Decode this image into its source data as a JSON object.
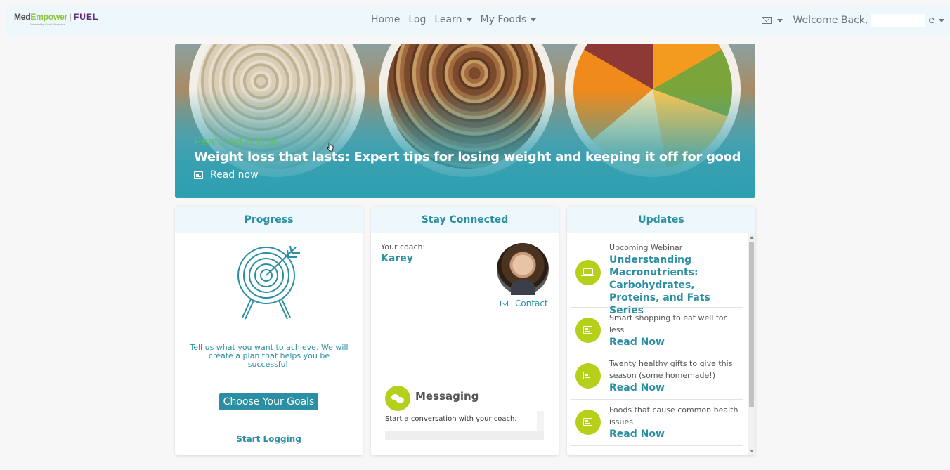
{
  "nav": {
    "logo": {
      "med": "Med",
      "empower": "Empower",
      "fuel": "FUEL",
      "tagline": "Powered by Good Measures"
    },
    "items": [
      {
        "label": "Home"
      },
      {
        "label": "Log"
      },
      {
        "label": "Learn"
      },
      {
        "label": "My Foods"
      }
    ],
    "welcome_prefix": "Welcome Back,",
    "welcome_suffix": "e"
  },
  "hero": {
    "eyebrow": "Featured Article",
    "headline": "Weight loss that lasts: Expert tips for losing weight and keeping it off for good",
    "cta": "Read now"
  },
  "progress": {
    "title": "Progress",
    "description": "Tell us what you want to achieve. We will create a plan that helps you be successful.",
    "button": "Choose Your Goals",
    "link": "Start Logging"
  },
  "connected": {
    "title": "Stay Connected",
    "coach_label": "Your coach:",
    "coach_name": "Karey",
    "contact": "Contact",
    "messaging_title": "Messaging",
    "messaging_text": "Start a conversation with your coach."
  },
  "updates": {
    "title": "Updates",
    "items": [
      {
        "pre": "Upcoming Webinar",
        "link": "Understanding Macronutrients: Carbohydrates, Proteins, and Fats Series",
        "icon": "laptop-icon"
      },
      {
        "pre": "Smart shopping to eat well for less",
        "link": "Read Now",
        "icon": "newspaper-icon"
      },
      {
        "pre": "Twenty healthy gifts to give this season (some homemade!)",
        "link": "Read Now",
        "icon": "newspaper-icon"
      },
      {
        "pre": "Foods that cause common health issues",
        "link": "Read Now",
        "icon": "newspaper-icon"
      }
    ]
  },
  "colors": {
    "accent": "#2a8fa3",
    "lime": "#b5cf1a",
    "header_bg": "#eef7fb"
  }
}
